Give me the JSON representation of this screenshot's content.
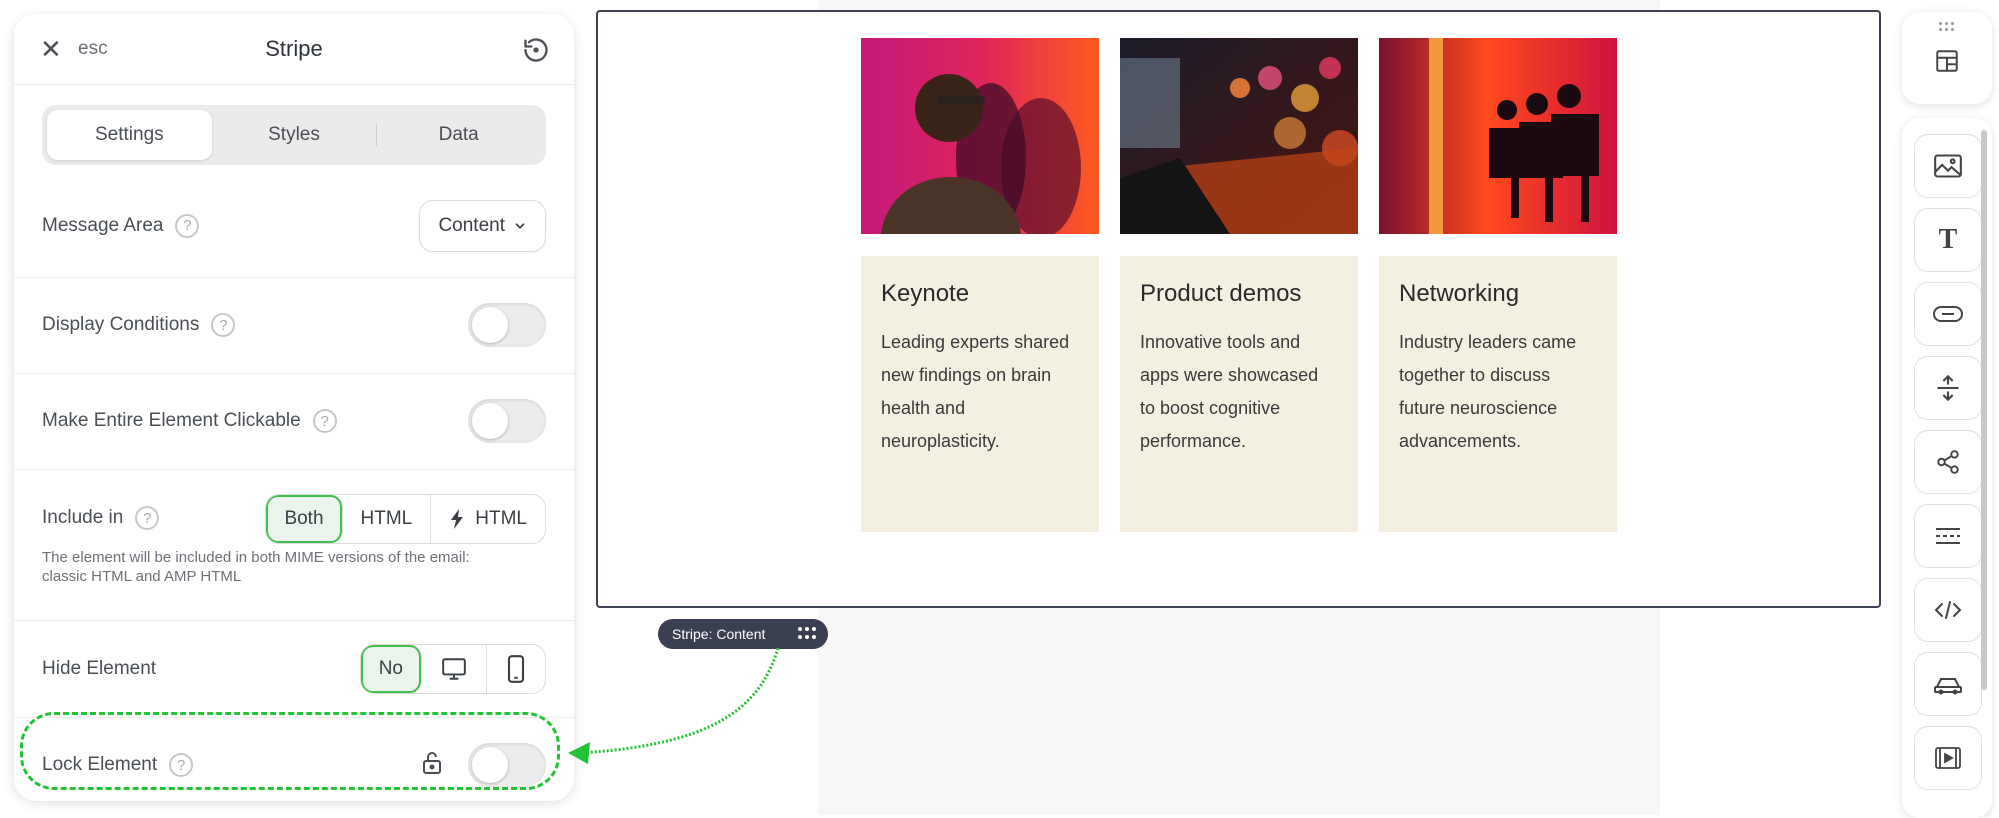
{
  "panel": {
    "title": "Stripe",
    "esc_label": "esc",
    "tabs": [
      {
        "label": "Settings",
        "active": true
      },
      {
        "label": "Styles",
        "active": false
      },
      {
        "label": "Data",
        "active": false
      }
    ],
    "message_area": {
      "label": "Message Area",
      "value": "Content"
    },
    "display_conditions": {
      "label": "Display Conditions",
      "enabled": false
    },
    "make_clickable": {
      "label": "Make Entire Element Clickable",
      "enabled": false
    },
    "include_in": {
      "label": "Include in",
      "options": [
        "Both",
        "HTML",
        "HTML"
      ],
      "selected": "Both",
      "help": "The element will be included in both MIME versions of the email: classic HTML and AMP HTML"
    },
    "hide_element": {
      "label": "Hide Element",
      "selected_label": "No"
    },
    "lock_element": {
      "label": "Lock Element",
      "enabled": false
    }
  },
  "canvas": {
    "stripe_pill": "Stripe: Content",
    "cards": [
      {
        "title": "Keynote",
        "text": "Leading experts shared new findings on brain health and neuroplasticity."
      },
      {
        "title": "Product demos",
        "text": "Innovative tools and apps were showcased to boost cognitive performance."
      },
      {
        "title": "Networking",
        "text": "Industry leaders came together to discuss future neuroscience advancements."
      }
    ]
  },
  "toolbar": {
    "top": "layout-blocks-icon",
    "items": [
      "image-icon",
      "text-icon",
      "button-icon",
      "spacer-icon",
      "social-icon",
      "divider-icon",
      "html-icon",
      "amp-icon",
      "video-icon"
    ]
  },
  "colors": {
    "accent_green": "#22c334",
    "selection_border": "#3e4255",
    "card_bg": "#f3efe1"
  }
}
